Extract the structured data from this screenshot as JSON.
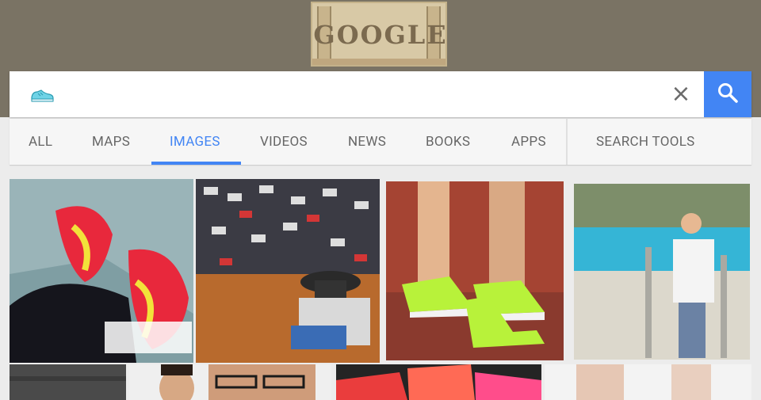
{
  "doodle": {
    "text": "GOOGLE"
  },
  "search": {
    "value": "",
    "query_icon": "shoe-icon",
    "clear_label": "×"
  },
  "tabs": [
    {
      "label": "ALL",
      "active": false
    },
    {
      "label": "MAPS",
      "active": false
    },
    {
      "label": "IMAGES",
      "active": true
    },
    {
      "label": "VIDEOS",
      "active": false
    },
    {
      "label": "NEWS",
      "active": false
    },
    {
      "label": "BOOKS",
      "active": false
    },
    {
      "label": "APPS",
      "active": false
    }
  ],
  "search_tools": {
    "label": "SEARCH TOOLS"
  },
  "colors": {
    "accent": "#4285f4",
    "top_band": "#7a7364",
    "tab_text": "#666666",
    "background": "#ececec"
  }
}
